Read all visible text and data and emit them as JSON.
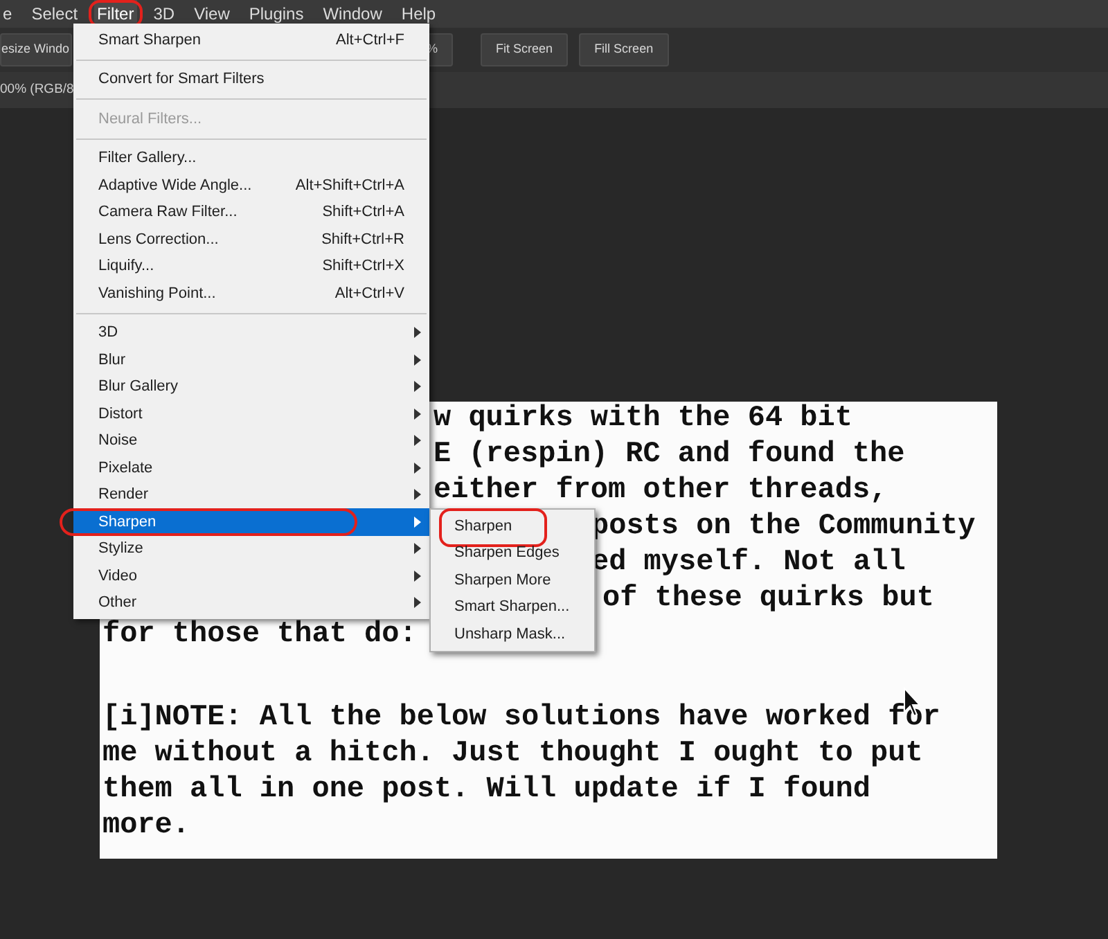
{
  "menu_bar": [
    {
      "label": "e",
      "selected": false,
      "circled": false
    },
    {
      "label": "Select",
      "selected": false,
      "circled": false
    },
    {
      "label": "Filter",
      "selected": true,
      "circled": true
    },
    {
      "label": "3D",
      "selected": false,
      "circled": false
    },
    {
      "label": "View",
      "selected": false,
      "circled": false
    },
    {
      "label": "Plugins",
      "selected": false,
      "circled": false
    },
    {
      "label": "Window",
      "selected": false,
      "circled": false
    },
    {
      "label": "Help",
      "selected": false,
      "circled": false
    }
  ],
  "options_bar": {
    "buttons": [
      {
        "label": "esize Windo"
      },
      {
        "label": "%"
      },
      {
        "label": "Fit Screen"
      },
      {
        "label": "Fill Screen"
      }
    ]
  },
  "document_tab": {
    "title": "00% (RGB/8"
  },
  "document_paragraphs": [
    [
      "w quirks with the 64 bit",
      "E (respin) RC and found the",
      "either from other threads,",
      "posts on the Community",
      "ed myself. Not all",
      "of these quirks but",
      "for those that do:"
    ],
    [
      "[i]NOTE: All the below solutions have worked for",
      "me without a hitch. Just thought I ought to put",
      "them all in one post. Will update if I found",
      "more."
    ]
  ],
  "filter_menu": {
    "sections": [
      [
        {
          "label": "Smart Sharpen",
          "shortcut": "Alt+Ctrl+F",
          "disabled": false,
          "submenu": false,
          "selected": false,
          "circled": false
        }
      ],
      [
        {
          "label": "Convert for Smart Filters",
          "disabled": false,
          "submenu": false,
          "selected": false,
          "circled": false
        }
      ],
      [
        {
          "label": "Neural Filters...",
          "disabled": true,
          "submenu": false,
          "selected": false,
          "circled": false
        }
      ],
      [
        {
          "label": "Filter Gallery...",
          "disabled": false,
          "submenu": false,
          "selected": false,
          "circled": false
        },
        {
          "label": "Adaptive Wide Angle...",
          "shortcut": "Alt+Shift+Ctrl+A",
          "disabled": false,
          "submenu": false,
          "selected": false,
          "circled": false
        },
        {
          "label": "Camera Raw Filter...",
          "shortcut": "Shift+Ctrl+A",
          "disabled": false,
          "submenu": false,
          "selected": false,
          "circled": false
        },
        {
          "label": "Lens Correction...",
          "shortcut": "Shift+Ctrl+R",
          "disabled": false,
          "submenu": false,
          "selected": false,
          "circled": false
        },
        {
          "label": "Liquify...",
          "shortcut": "Shift+Ctrl+X",
          "disabled": false,
          "submenu": false,
          "selected": false,
          "circled": false
        },
        {
          "label": "Vanishing Point...",
          "shortcut": "Alt+Ctrl+V",
          "disabled": false,
          "submenu": false,
          "selected": false,
          "circled": false
        }
      ],
      [
        {
          "label": "3D",
          "disabled": false,
          "submenu": true,
          "selected": false,
          "circled": false
        },
        {
          "label": "Blur",
          "disabled": false,
          "submenu": true,
          "selected": false,
          "circled": false
        },
        {
          "label": "Blur Gallery",
          "disabled": false,
          "submenu": true,
          "selected": false,
          "circled": false
        },
        {
          "label": "Distort",
          "disabled": false,
          "submenu": true,
          "selected": false,
          "circled": false
        },
        {
          "label": "Noise",
          "disabled": false,
          "submenu": true,
          "selected": false,
          "circled": false
        },
        {
          "label": "Pixelate",
          "disabled": false,
          "submenu": true,
          "selected": false,
          "circled": false
        },
        {
          "label": "Render",
          "disabled": false,
          "submenu": true,
          "selected": false,
          "circled": false
        },
        {
          "label": "Sharpen",
          "disabled": false,
          "submenu": true,
          "selected": true,
          "circled": true
        },
        {
          "label": "Stylize",
          "disabled": false,
          "submenu": true,
          "selected": false,
          "circled": false
        },
        {
          "label": "Video",
          "disabled": false,
          "submenu": true,
          "selected": false,
          "circled": false
        },
        {
          "label": "Other",
          "disabled": false,
          "submenu": true,
          "selected": false,
          "circled": false
        }
      ]
    ]
  },
  "sharpen_submenu": [
    {
      "label": "Sharpen",
      "selected": false,
      "circled": true
    },
    {
      "label": "Sharpen Edges",
      "selected": false,
      "circled": false
    },
    {
      "label": "Sharpen More",
      "selected": false,
      "circled": false
    },
    {
      "label": "Smart Sharpen...",
      "selected": false,
      "circled": false
    },
    {
      "label": "Unsharp Mask...",
      "selected": false,
      "circled": false
    }
  ]
}
